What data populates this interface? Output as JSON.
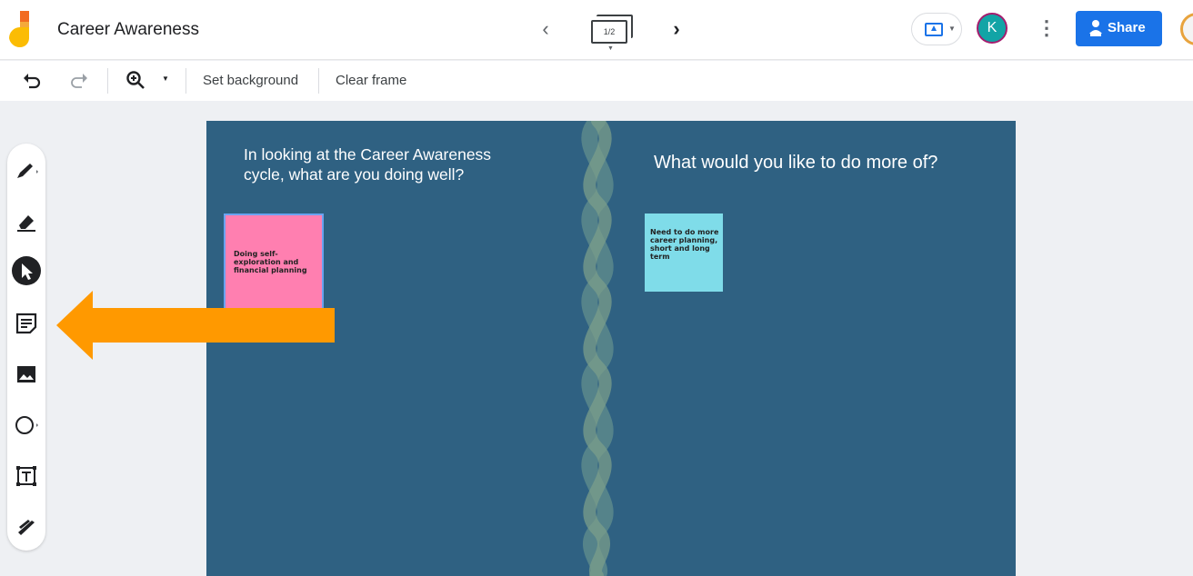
{
  "header": {
    "app_title": "Career Awareness",
    "frame_counter": "1/2",
    "avatar_initial": "K",
    "share_label": "Share"
  },
  "toolbar": {
    "set_background": "Set background",
    "clear_frame": "Clear frame"
  },
  "tools": [
    "pen-tool",
    "eraser-tool",
    "select-tool",
    "sticky-note-tool",
    "image-tool",
    "shape-tool",
    "text-box-tool",
    "laser-tool"
  ],
  "canvas": {
    "left_prompt": "In looking at the Career Awareness cycle, what are you doing well?",
    "right_prompt": "What would you like to do more of?",
    "notes": {
      "pink": "Doing self-exploration and financial planning",
      "cyan": "Need to do more career planning, short and long term"
    }
  },
  "colors": {
    "canvas_bg": "#2f6182",
    "pink_note": "#ff7fb0",
    "cyan_note": "#7fdce9",
    "share_button": "#1a73e8",
    "arrow": "#ff9900"
  }
}
